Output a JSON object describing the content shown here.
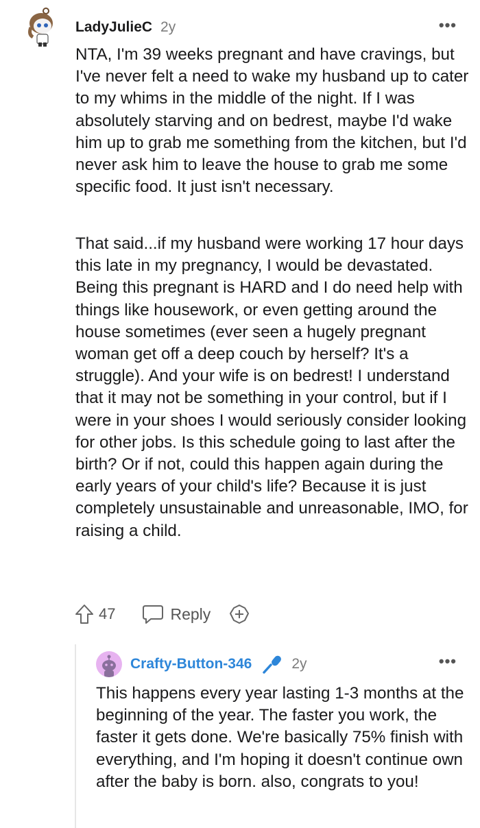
{
  "comment1": {
    "username": "LadyJulieC",
    "age": "2y",
    "more_label": "•••",
    "paragraphs": [
      "NTA, I'm 39 weeks pregnant and have cravings, but I've never felt a need to wake my husband up to cater to my whims in the middle of the night. If I was absolutely starving and on bedrest, maybe I'd wake him up to grab me something from the kitchen, but I'd never ask him to leave the house to grab me some specific food. It just isn't necessary.",
      "That said...if my husband were working 17 hour days this late in my pregnancy, I would be devastated. Being this pregnant is HARD and I do need help with things like housework, or even getting around the house sometimes (ever seen a hugely pregnant woman get off a deep couch by herself? It's a struggle). And your wife is on bedrest! I understand that it may not be something in your control, but if I were in your shoes I would seriously consider looking for other jobs. Is this schedule going to last after the birth? Or if not, could this happen again during the early years of your child's life? Because it is just completely unsustainable and unreasonable, IMO, for raising a child."
    ],
    "upvotes": "47",
    "reply_label": "Reply",
    "icons": [
      "avatar",
      "upvote-arrow-icon",
      "reply-bubble-icon",
      "award-plus-icon",
      "more-options-icon"
    ]
  },
  "comment2": {
    "username": "Crafty-Button-346",
    "age": "2y",
    "more_label": "•••",
    "text": "This happens every year lasting 1-3 months at the beginning of the year. The faster you work, the faster it gets done. We're basically 75% finish with everything, and I'm hoping it doesn't continue own after the baby is born. also, congrats to you!",
    "icons": [
      "avatar",
      "microphone-icon",
      "more-options-icon"
    ]
  },
  "colors": {
    "username_link": "#2d86d9",
    "microphone": "#2d86d9",
    "avatar2_bg": "#e7b3f0",
    "muted": "#7c7c7c"
  }
}
